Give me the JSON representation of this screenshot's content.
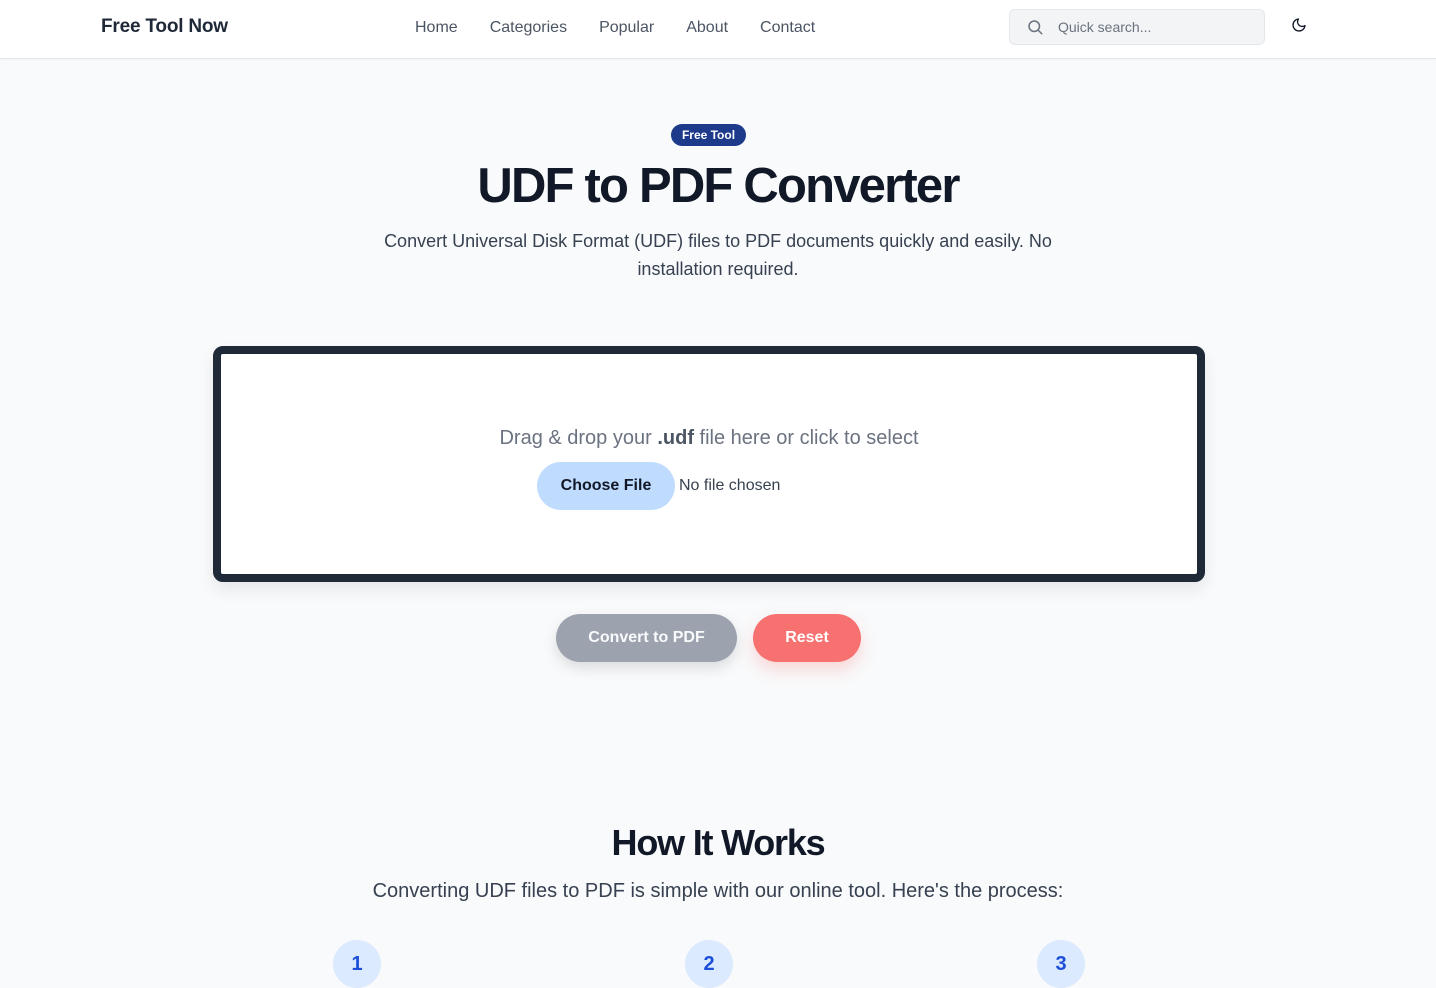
{
  "header": {
    "brand": "Free Tool Now",
    "nav": [
      "Home",
      "Categories",
      "Popular",
      "About",
      "Contact"
    ],
    "search_placeholder": "Quick search...",
    "search_icon": "search-icon",
    "theme_icon": "moon-icon"
  },
  "hero": {
    "badge": "Free Tool",
    "title": "UDF to PDF Converter",
    "subtitle": "Convert Universal Disk Format (UDF) files to PDF documents quickly and easily. No installation required."
  },
  "upload": {
    "prompt_before": "Drag & drop your ",
    "prompt_ext": ".udf",
    "prompt_after": " file here or click to select",
    "choose_label": "Choose File",
    "file_status": "No file chosen"
  },
  "actions": {
    "convert_label": "Convert to PDF",
    "reset_label": "Reset",
    "convert_disabled": true
  },
  "how_it_works": {
    "title": "How It Works",
    "subtitle": "Converting UDF files to PDF is simple with our online tool. Here's the process:",
    "steps": [
      "1",
      "2",
      "3"
    ]
  },
  "colors": {
    "badge_bg": "#1e3a8a",
    "dropzone_border": "#1f2937",
    "choose_bg": "#bfdbfe",
    "convert_bg": "#9ca3af",
    "reset_bg": "#f87171",
    "step_bg": "#dbeafe",
    "step_text": "#1d4ed8"
  }
}
